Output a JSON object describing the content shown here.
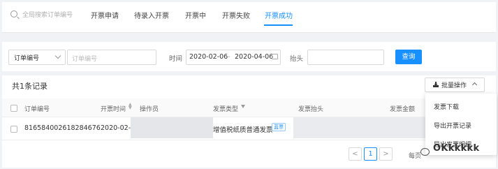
{
  "tabbar": {
    "search_placeholder": "全局搜索订单编号",
    "tabs": [
      {
        "label": "开票申请"
      },
      {
        "label": "待录入开票"
      },
      {
        "label": "开票中"
      },
      {
        "label": "开票失败"
      },
      {
        "label": "开票成功"
      }
    ],
    "active_tab": "开票成功",
    "accent_color": "#1890ff"
  },
  "filter": {
    "field_select": "订单编号",
    "field_placeholder": "订单编号",
    "time_label": "时间",
    "date_start": "2020-02-06",
    "date_sep": "-",
    "date_end": "2020-04-06",
    "header_label": "抬头",
    "query_button": "查询"
  },
  "table": {
    "count_text": "共1条记录",
    "batch_button": "批量操作",
    "columns": [
      "订单编号",
      "开票时间",
      "操作员",
      "发票类型",
      "发票抬头",
      "发票金额"
    ],
    "rows": [
      {
        "order_no": "816584002618284676",
        "time": "2020-02-",
        "invoice_type": "增值税纸质普通发票",
        "tag": "蓝票"
      }
    ]
  },
  "pagination": {
    "prev": "<",
    "current": "1",
    "next": ">",
    "tail": "每页"
  },
  "dropdown": {
    "items": [
      "发票下载",
      "导出开票记录",
      "导出发票明细"
    ]
  },
  "watermark": "OKkkkkk"
}
